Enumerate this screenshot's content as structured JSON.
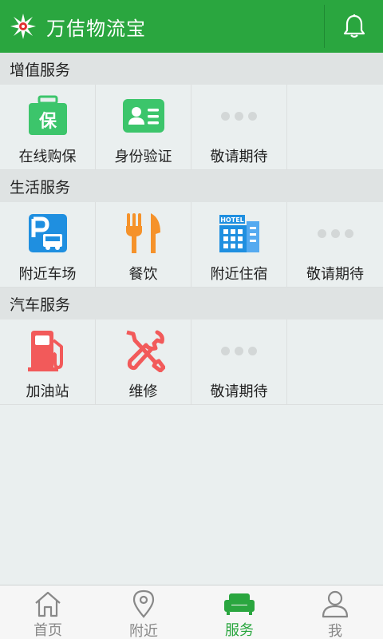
{
  "header": {
    "title": "万佶物流宝",
    "brand_color": "#2aa63f"
  },
  "sections": [
    {
      "title": "增值服务",
      "items": [
        {
          "label": "在线购保",
          "icon": "insurance-briefcase-icon"
        },
        {
          "label": "身份验证",
          "icon": "id-card-icon"
        },
        {
          "label": "敬请期待",
          "icon": "more-dots-icon"
        }
      ]
    },
    {
      "title": "生活服务",
      "items": [
        {
          "label": "附近车场",
          "icon": "parking-truck-icon"
        },
        {
          "label": "餐饮",
          "icon": "fork-knife-icon"
        },
        {
          "label": "附近住宿",
          "icon": "hotel-icon"
        },
        {
          "label": "敬请期待",
          "icon": "more-dots-icon"
        }
      ]
    },
    {
      "title": "汽车服务",
      "items": [
        {
          "label": "加油站",
          "icon": "fuel-pump-icon"
        },
        {
          "label": "维修",
          "icon": "repair-tools-icon"
        },
        {
          "label": "敬请期待",
          "icon": "more-dots-icon"
        }
      ]
    }
  ],
  "icon_badges": {
    "insurance": "保",
    "hotel": "HOTEL"
  },
  "tabs": [
    {
      "label": "首页",
      "icon": "home-icon",
      "active": false
    },
    {
      "label": "附近",
      "icon": "location-pin-icon",
      "active": false
    },
    {
      "label": "服务",
      "icon": "sofa-icon",
      "active": true
    },
    {
      "label": "我",
      "icon": "user-icon",
      "active": false
    }
  ]
}
